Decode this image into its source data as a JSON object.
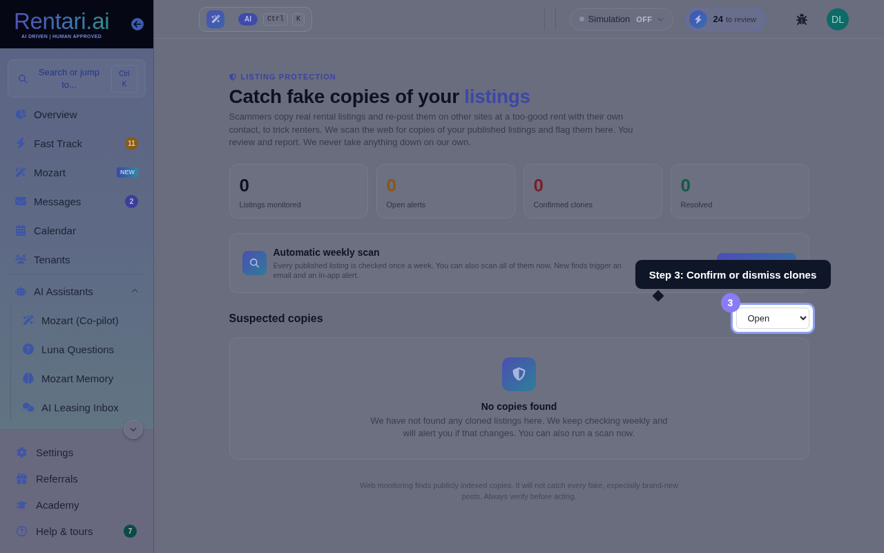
{
  "sidebar": {
    "logo": {
      "name": "Rentari.ai",
      "tagline": "AI DRIVEN | HUMAN APPROVED"
    },
    "search": {
      "placeholder": "Search or jump to...",
      "shortcut": "Ctrl K"
    },
    "nav": [
      {
        "label": "Overview"
      },
      {
        "label": "Fast Track",
        "badge": {
          "kind": "count",
          "text": "11",
          "color": "#8a5a16"
        }
      },
      {
        "label": "Mozart",
        "badge": {
          "kind": "tag",
          "text": "NEW"
        }
      },
      {
        "label": "Messages",
        "badge": {
          "kind": "count",
          "text": "2",
          "color": "#3a3e98"
        }
      },
      {
        "label": "Calendar"
      },
      {
        "label": "Tenants"
      },
      {
        "label": "AI Assistants",
        "expanded": true,
        "children": [
          {
            "label": "Mozart (Co-pilot)"
          },
          {
            "label": "Luna Questions"
          },
          {
            "label": "Mozart Memory"
          },
          {
            "label": "AI Leasing Inbox"
          }
        ]
      }
    ],
    "footer_nav": [
      {
        "label": "Settings"
      },
      {
        "label": "Referrals"
      },
      {
        "label": "Academy"
      },
      {
        "label": "Help & tours",
        "badge": {
          "kind": "count",
          "text": "7",
          "color": "#0c4a45"
        }
      }
    ]
  },
  "topbar": {
    "command": {
      "badge": "AI",
      "keys": [
        "Ctrl",
        "K"
      ]
    },
    "simulation": {
      "label": "Simulation",
      "state": "OFF",
      "on": false
    },
    "review": {
      "count": "24",
      "label": "to review"
    },
    "avatar": {
      "initials": "DL"
    }
  },
  "page": {
    "eyebrow": "LISTING PROTECTION",
    "title": "Catch fake copies of your",
    "title_accent": "listings",
    "description": "Scammers copy real rental listings and re-post them on other sites at a too-good rent with their own contact, to trick renters. We scan the web for copies of your published listings and flag them here. You review and report. We never take anything down on our own.",
    "stats": [
      {
        "value": "0",
        "label": "Listings monitored",
        "color": "#0d1120"
      },
      {
        "value": "0",
        "label": "Open alerts",
        "color": "#8a561a"
      },
      {
        "value": "0",
        "label": "Confirmed clones",
        "color": "#7b1d2b"
      },
      {
        "value": "0",
        "label": "Resolved",
        "color": "#115a48"
      }
    ],
    "scan": {
      "title": "Automatic weekly scan",
      "description": "Every published listing is checked once a week. You can also scan all of them now. New finds trigger an email and an in-app alert."
    },
    "suspected": {
      "title": "Suspected copies",
      "filter": "Open",
      "empty": {
        "title": "No copies found",
        "description": "We have not found any cloned listings here. We keep checking weekly and will alert you if that changes. You can also run a scan now."
      }
    },
    "note": "Web monitoring finds publicly indexed copies. It will not catch every fake, especially brand-new posts. Always verify before acting."
  },
  "tour": {
    "step": "3",
    "text": "Step 3: Confirm or dismiss clones"
  }
}
